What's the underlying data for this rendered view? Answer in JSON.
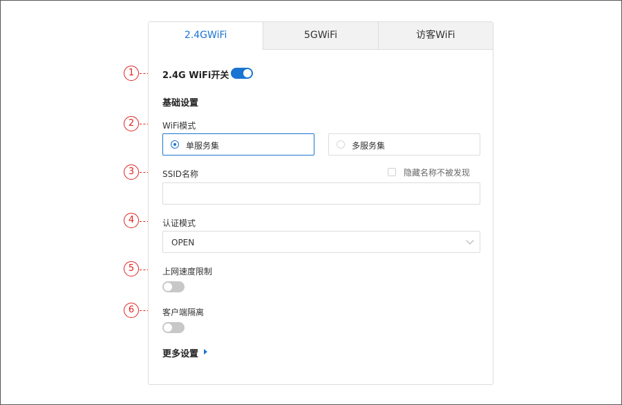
{
  "tabs": [
    {
      "label": "2.4GWiFi",
      "active": true
    },
    {
      "label": "5GWiFi",
      "active": false
    },
    {
      "label": "访客WiFi",
      "active": false
    }
  ],
  "wifi_switch": {
    "label": "2.4G WiFi开关",
    "on": true
  },
  "basic_settings_heading": "基础设置",
  "wifi_mode": {
    "label": "WiFi模式",
    "options": [
      {
        "label": "单服务集",
        "selected": true
      },
      {
        "label": "多服务集",
        "selected": false
      }
    ]
  },
  "ssid": {
    "label": "SSID名称",
    "value": "",
    "hide_label": "隐藏名称不被发现",
    "hidden": false
  },
  "auth_mode": {
    "label": "认证模式",
    "selected": "OPEN"
  },
  "speed_limit": {
    "label": "上网速度限制",
    "on": false
  },
  "client_isolation": {
    "label": "客户端隔离",
    "on": false
  },
  "more_settings": "更多设置",
  "markers": [
    "1",
    "2",
    "3",
    "4",
    "5",
    "6"
  ],
  "colors": {
    "accent": "#1a74d2",
    "marker": "#e02020"
  }
}
